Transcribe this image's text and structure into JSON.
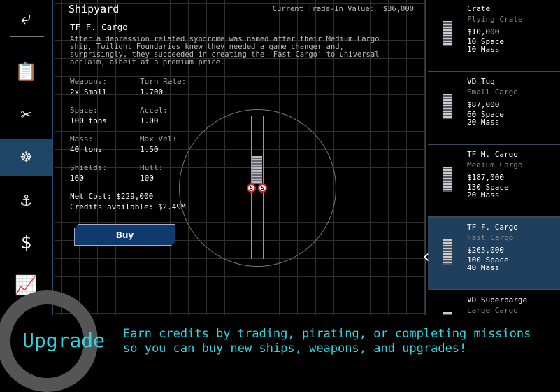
{
  "sidebar": {
    "items": [
      {
        "icon": "back-arrow-icon",
        "glyph": "⤶"
      },
      {
        "icon": "clipboard-icon",
        "glyph": "📋"
      },
      {
        "icon": "wrench-screwdriver-icon",
        "glyph": "✂"
      },
      {
        "icon": "ship-wheel-icon",
        "glyph": "☸",
        "active": true
      },
      {
        "icon": "crane-hook-icon",
        "glyph": "⚓"
      },
      {
        "icon": "hand-dollar-icon",
        "glyph": "$"
      },
      {
        "icon": "chart-up-icon",
        "glyph": "📈"
      }
    ]
  },
  "header": {
    "title": "Shipyard",
    "trade_in": "Current Trade-In Value:  $36,000"
  },
  "ship": {
    "name": "TF F. Cargo",
    "description": "After a depression related syndrome was named after their Medium Cargo\nship, Twilight Foundaries knew they needed a game changer and,\nsurprisingly, they succeeded in creating the 'Fast Cargo' to universal\nacclaim, albeit at a premium price.",
    "stats": [
      {
        "label": "Weapons:",
        "value": "2x Small"
      },
      {
        "label": "Turn Rate:",
        "value": "1.700"
      },
      {
        "label": "Space:",
        "value": "100 tons"
      },
      {
        "label": "Accel:",
        "value": "1.00"
      },
      {
        "label": "Mass:",
        "value": "40 tons"
      },
      {
        "label": "Max Vel:",
        "value": "1.50"
      },
      {
        "label": "Shields:",
        "value": "160"
      },
      {
        "label": "Hull:",
        "value": "100"
      }
    ],
    "net_cost": "Net Cost: $229,000",
    "credits": "Credits available: $2.49M",
    "buy_label": "Buy",
    "slot_label": "S"
  },
  "list": [
    {
      "name": "Crate",
      "class": "Flying Crate",
      "price": "$10,000",
      "space": "10 Space",
      "mass": "10 Mass"
    },
    {
      "name": "VD Tug",
      "class": "Small Cargo",
      "price": "$87,000",
      "space": "60 Space",
      "mass": "20 Mass"
    },
    {
      "name": "TF M. Cargo",
      "class": "Medium Cargo",
      "price": "$187,000",
      "space": "130 Space",
      "mass": "20 Mass"
    },
    {
      "name": "TF F. Cargo",
      "class": "Fast Cargo",
      "price": "$265,000",
      "space": "100 Space",
      "mass": "40 Mass",
      "selected": true
    },
    {
      "name": "VD Superbarge",
      "class": "Large Cargo"
    }
  ],
  "banner": {
    "title": "Upgrade",
    "message": "Earn credits by trading, pirating, or completing missions\nso you can buy new ships, weapons, and upgrades!"
  },
  "colors": {
    "accent": "#2fd6e0",
    "selected": "#1f3f5c",
    "button": "#0e3a6e"
  }
}
